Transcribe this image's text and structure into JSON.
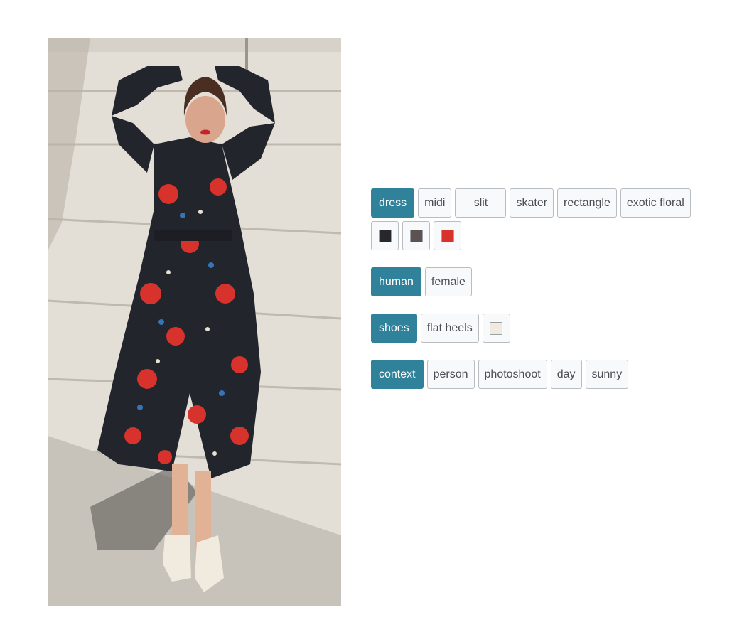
{
  "photo": {
    "alt_icon": "fashion-photo"
  },
  "groups": [
    {
      "category": "dress",
      "tags": [
        "midi",
        "slit",
        "skater",
        "rectangle",
        "exotic floral"
      ],
      "colors": [
        "#28282c",
        "#5c5251",
        "#d8322c"
      ]
    },
    {
      "category": "human",
      "tags": [
        "female"
      ],
      "colors": []
    },
    {
      "category": "shoes",
      "tags": [
        "flat heels"
      ],
      "colors": [
        "#f1ebdf"
      ]
    },
    {
      "category": "context",
      "tags": [
        "person",
        "photoshoot",
        "day",
        "sunny"
      ],
      "colors": []
    }
  ]
}
